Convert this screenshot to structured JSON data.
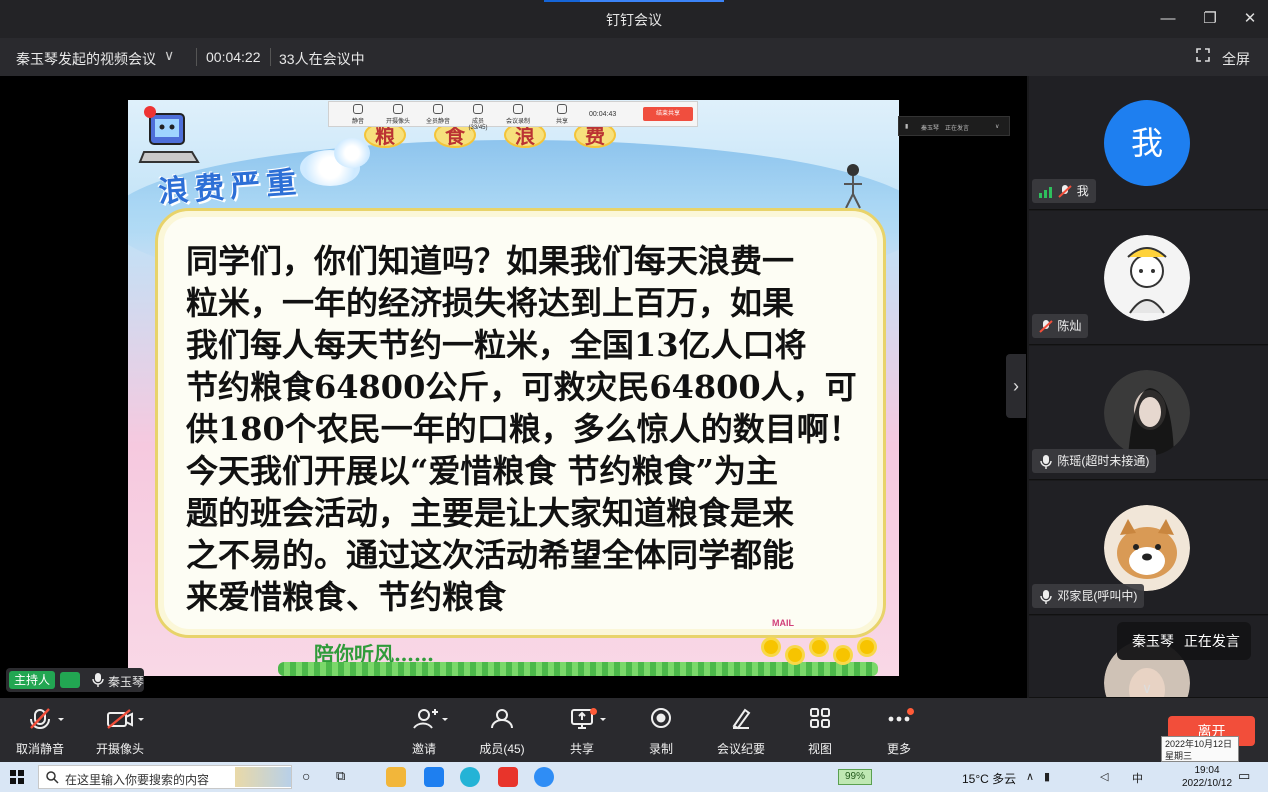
{
  "window": {
    "title": "钉钉会议",
    "controls": [
      "minimize-icon",
      "restore-icon",
      "close-icon"
    ]
  },
  "info_bar": {
    "meeting_name": "秦玉琴发起的视频会议",
    "elapsed": "00:04:22",
    "participants": "33人在会议中",
    "fullscreen_label": "全屏"
  },
  "slide": {
    "header_chars": [
      "粮",
      "食",
      "浪",
      "费"
    ],
    "heading": "浪费严重",
    "lines": [
      "同学们，你们知道吗？如果我们每天浪费一",
      "粒米，一年的经济损失将达到上百万，如果",
      "我们每人每天节约一粒米，全国13亿人口将",
      "节约粮食64800公斤，可救灾民64800人，可",
      "供180个农民一年的口粮，多么惊人的数目啊！",
      "今天我们开展以“爱惜粮食 节约粮食”为主",
      "题的班会活动，主要是让大家知道粮食是来",
      "之不易的。通过这次活动希望全体同学都能",
      "来爱惜粮食、节约粮食"
    ],
    "footer": "陪你听风……",
    "mail": "MAIL"
  },
  "mini_toolbar": {
    "items": [
      "静音",
      "开摄像头",
      "全员静音",
      "成员(33/45)",
      "会议录制",
      "共享"
    ],
    "time": "00:04:43",
    "end_label": "结束共享"
  },
  "mini_speaker": {
    "name": "秦玉琴",
    "status": "正在发言"
  },
  "host_tag": {
    "role": "主持人",
    "name": "秦玉琴"
  },
  "participants": [
    {
      "label": "我",
      "avatar_text": "我",
      "icon": "mic-muted-icon",
      "signal": true
    },
    {
      "label": "陈灿",
      "avatar_text": "",
      "icon": "mic-muted-icon"
    },
    {
      "label": "陈瑶(超时未接通)",
      "avatar_text": "",
      "icon": "mic-icon"
    },
    {
      "label": "邓家昆(呼叫中)",
      "avatar_text": "",
      "icon": "mic-icon"
    }
  ],
  "speaking_toast": {
    "name": "秦玉琴",
    "status": "正在发言"
  },
  "toolbar": {
    "left": [
      {
        "label": "取消静音",
        "icon": "mic-muted-icon"
      },
      {
        "label": "开摄像头",
        "icon": "camera-off-icon"
      }
    ],
    "center": [
      {
        "label": "邀请",
        "icon": "add-person-icon"
      },
      {
        "label": "成员(45)",
        "icon": "members-icon"
      },
      {
        "label": "共享",
        "icon": "share-screen-icon"
      },
      {
        "label": "录制",
        "icon": "record-icon"
      },
      {
        "label": "会议纪要",
        "icon": "notes-icon"
      },
      {
        "label": "视图",
        "icon": "grid-view-icon"
      },
      {
        "label": "更多",
        "icon": "more-icon"
      }
    ],
    "leave_label": "离开"
  },
  "date_tooltip": {
    "date": "2022年10月12日",
    "weekday": "星期三"
  },
  "taskbar": {
    "search_placeholder": "在这里输入你要搜索的内容",
    "battery": "99%",
    "weather": "15°C 多云",
    "ime": "中",
    "time": "19:04",
    "date": "2022/10/12"
  },
  "colors": {
    "accent": "#3b83f7",
    "host_green": "#22a652",
    "leave_red": "#f24e3a",
    "avatar_blue": "#1e7ff0"
  }
}
